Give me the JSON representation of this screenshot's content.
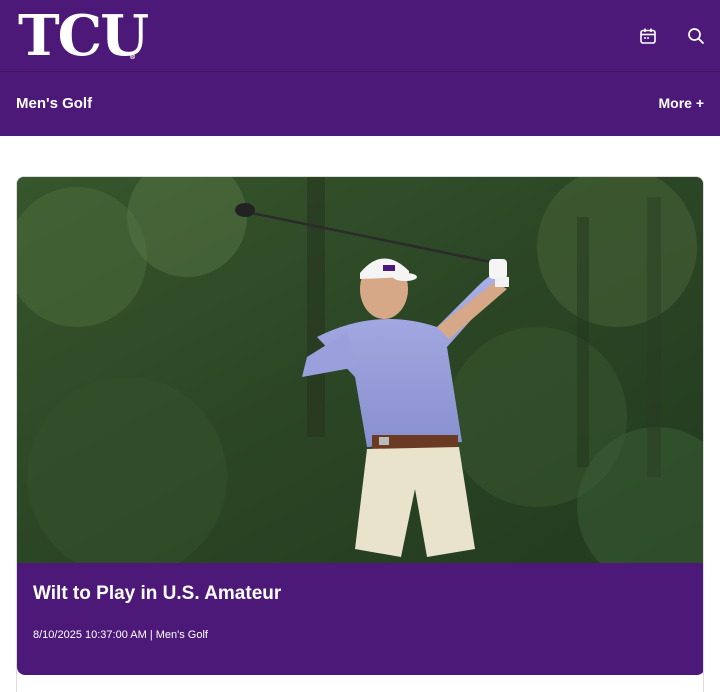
{
  "header": {
    "logo_text": "TCU",
    "logo_mark": "®",
    "icons": [
      "calendar-icon",
      "search-icon"
    ]
  },
  "subnav": {
    "title": "Men's Golf",
    "more_label": "More +"
  },
  "story": {
    "headline": "Wilt to Play in U.S. Amateur",
    "date": "8/10/2025 10:37:00 AM",
    "separator": "|",
    "category": "Men's Golf"
  },
  "colors": {
    "brand_purple": "#4d1979",
    "text_on_brand": "#ffffff"
  }
}
